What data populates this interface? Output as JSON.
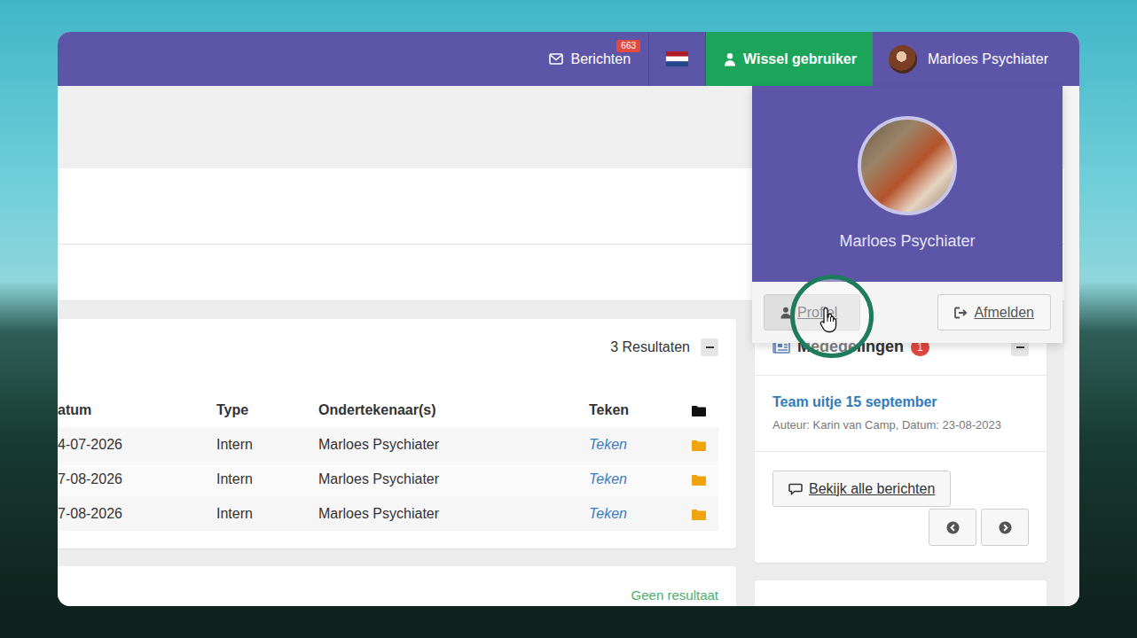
{
  "topbar": {
    "messages": {
      "label": "Berichten",
      "count": "663"
    },
    "switch_user": "Wissel gebruiker",
    "user_name": "Marloes Psychiater"
  },
  "user_menu": {
    "open": true,
    "name": "Marloes Psychiater",
    "buttons": [
      {
        "label": "Profiel",
        "kind": "profile",
        "hovered": true,
        "highlighted": true
      },
      {
        "label": "Afmelden",
        "kind": "logout",
        "hovered": false,
        "highlighted": false
      }
    ]
  },
  "documents": {
    "result_count": "3 Resultaten",
    "columns": [
      "atum",
      "Type",
      "Ondertekenaar(s)",
      "Teken"
    ],
    "rows": [
      [
        "4-07-2026",
        "Intern",
        "Marloes Psychiater",
        "Teken"
      ],
      [
        "7-08-2026",
        "Intern",
        "Marloes Psychiater",
        "Teken"
      ],
      [
        "7-08-2026",
        "Intern",
        "Marloes Psychiater",
        "Teken"
      ]
    ]
  },
  "second_panel": {
    "empty_text": "Geen resultaat"
  },
  "announcements": {
    "title": "Mededelingen",
    "count": "1",
    "items": [
      {
        "title": "Team uitje 15 september",
        "meta": "Auteur: Karin van Camp, Datum: 23-08-2023"
      }
    ],
    "all_button": "Bekijk alle berichten"
  }
}
